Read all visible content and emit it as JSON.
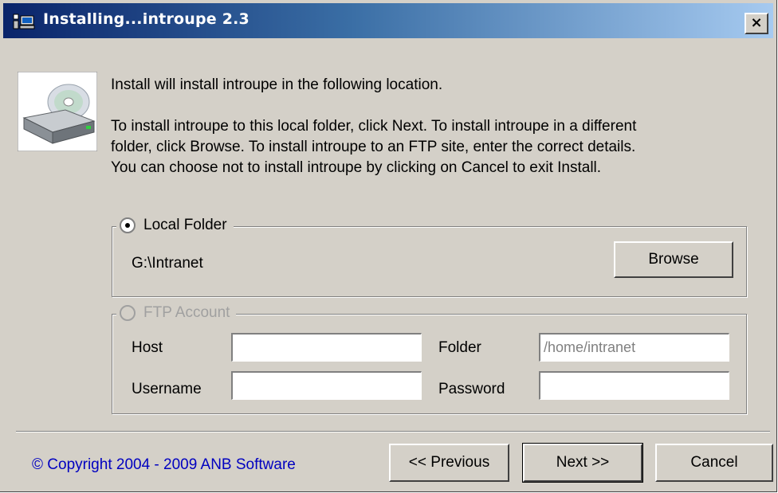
{
  "window": {
    "title": "Installing...introupe 2.3",
    "close_glyph": "×"
  },
  "intro": {
    "line1": "Install will install introupe in the following location.",
    "line2": "To install introupe to this local folder, click Next. To install introupe in a different",
    "line3": "folder, click Browse. To install introupe to an FTP site, enter the correct details.",
    "line4": "You can choose not to install introupe by clicking on Cancel to exit Install."
  },
  "local": {
    "label": "Local Folder",
    "selected": true,
    "path": "G:\\Intranet",
    "browse_label": "Browse"
  },
  "ftp": {
    "label": "FTP Account",
    "enabled": false,
    "host_label": "Host",
    "host_value": "",
    "username_label": "Username",
    "username_value": "",
    "folder_label": "Folder",
    "folder_value": "/home/intranet",
    "password_label": "Password",
    "password_value": ""
  },
  "footer": {
    "copyright": "© Copyright 2004 - 2009 ANB Software",
    "previous_label": "<< Previous",
    "next_label": "Next >>",
    "cancel_label": "Cancel"
  },
  "colors": {
    "titlebar_start": "#0a246a",
    "titlebar_end": "#a6caf0",
    "face": "#d4d0c8",
    "link": "#0000c0"
  },
  "icons": {
    "app": "installer-app-icon",
    "drive": "cd-drive-icon"
  }
}
